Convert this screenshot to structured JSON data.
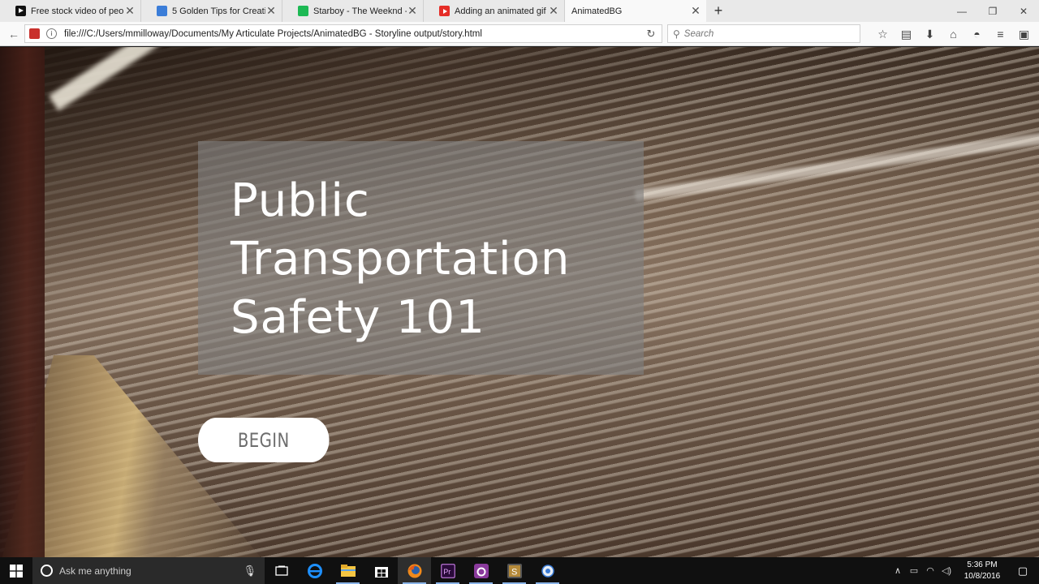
{
  "browser": {
    "tabs": [
      {
        "title": "Free stock video of peopl...",
        "favicon": "vimeo-icon",
        "active": false
      },
      {
        "title": "5 Golden Tips for Creating...",
        "favicon": "tips-icon",
        "active": false
      },
      {
        "title": "Starboy - The Weeknd - S...",
        "favicon": "spotify-icon",
        "active": false
      },
      {
        "title": "Adding an animated gif f...",
        "favicon": "youtube-icon",
        "active": false
      },
      {
        "title": "AnimatedBG",
        "favicon": "none",
        "active": true
      }
    ],
    "new_tab_label": "+",
    "url": "file:///C:/Users/mmilloway/Documents/My Articulate Projects/AnimatedBG - Storyline output/story.html",
    "search_placeholder": "Search"
  },
  "slide": {
    "title_lines": [
      "Public",
      "Transportation",
      "Safety 101"
    ],
    "begin_label": "BEGIN",
    "panel_color": "#808080",
    "button_color": "#ffffff"
  },
  "taskbar": {
    "search_placeholder": "Ask me anything",
    "apps": [
      "task-view-icon",
      "edge-icon",
      "file-explorer-icon",
      "store-icon",
      "firefox-icon",
      "premiere-icon",
      "articulate-icon",
      "storyline-icon",
      "quicktime-icon"
    ],
    "time": "5:36 PM",
    "date": "10/8/2016"
  }
}
